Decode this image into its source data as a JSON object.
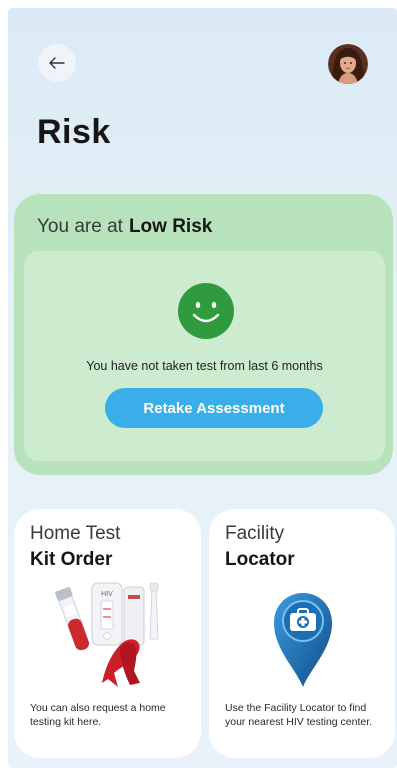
{
  "header": {
    "title": "Risk",
    "back_icon": "arrow-left-icon",
    "avatar_icon": "user-avatar"
  },
  "risk_card": {
    "prefix": "You are at",
    "level": "Low Risk",
    "status": "You have not taken test from last 6 months",
    "retake_label": "Retake Assessment",
    "icon": "smiley-icon",
    "colors": {
      "card": "#b7e2bc",
      "inner": "#cdeccf",
      "smiley": "#2f9a3e",
      "button": "#3aaee8"
    }
  },
  "cards": {
    "home_test": {
      "title_light": "Home Test",
      "title_bold": "Kit Order",
      "description": "You can also request a home testing kit here.",
      "illustration": "hiv-test-kit-illustration",
      "kit_label": "HIV"
    },
    "facility": {
      "title_light": "Facility",
      "title_bold": "Locator",
      "description": "Use the Facility Locator to find your nearest HIV testing center.",
      "illustration": "map-pin-medical-kit-icon"
    }
  }
}
